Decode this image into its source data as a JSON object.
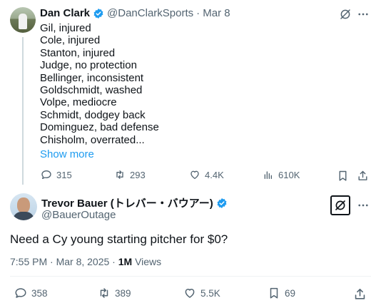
{
  "reply_tweet": {
    "author_name": "Dan Clark",
    "handle": "@DanClarkSports",
    "date": "· Mar 8",
    "lines": [
      "Gil, injured",
      "Cole, injured",
      "Stanton, injured",
      "Judge, no protection",
      "Bellinger, inconsistent",
      "Goldschmidt, washed",
      "Volpe, mediocre",
      "Schmidt, dodgey back",
      "Dominguez, bad defense",
      "Chisholm, overrated..."
    ],
    "show_more": "Show more",
    "stats": {
      "replies": "315",
      "reposts": "293",
      "likes": "4.4K",
      "views": "610K"
    }
  },
  "main_tweet": {
    "author_name": "Trevor Bauer (トレバー・バウアー)",
    "handle": "@BauerOutage",
    "text": "Need a Cy young starting pitcher for $0?",
    "time": "7:55 PM · Mar 8, 2025 · ",
    "views_count": "1M",
    "views_label": " Views",
    "stats": {
      "replies": "358",
      "reposts": "389",
      "likes": "5.5K",
      "bookmarks": "69"
    }
  },
  "colors": {
    "accent": "#1d9bf0",
    "text": "#0f1419",
    "muted": "#536471"
  },
  "icons": [
    "verified-badge-icon",
    "grok-icon",
    "more-icon",
    "reply-icon",
    "repost-icon",
    "like-icon",
    "views-icon",
    "bookmark-icon",
    "share-icon"
  ]
}
